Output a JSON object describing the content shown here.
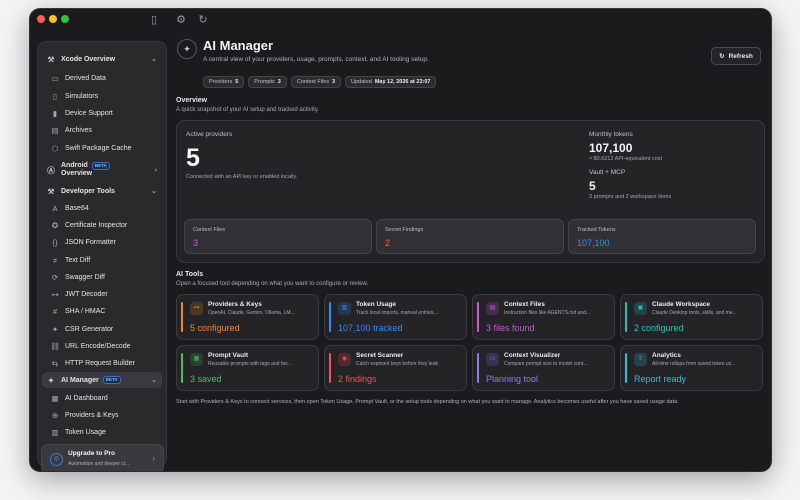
{
  "colors": {
    "window_bg": "#1b1b1d",
    "sidebar_bg": "#2a2a2d",
    "orange": "#f08a24",
    "blue": "#2f8cff",
    "magenta": "#c85ad8",
    "teal": "#22c3c8",
    "green": "#3ec45a",
    "red": "#ff4d4f",
    "purple": "#8b7cf6",
    "cyan": "#35b8e8"
  },
  "sidebar": {
    "items": [
      {
        "label": "Xcode Overview",
        "icon": "hammer-icon",
        "group": true
      },
      {
        "label": "Derived Data",
        "icon": "drive-icon"
      },
      {
        "label": "Simulators",
        "icon": "device-icon"
      },
      {
        "label": "Device Support",
        "icon": "phone-icon"
      },
      {
        "label": "Archives",
        "icon": "archive-icon"
      },
      {
        "label": "Swift Package Cache",
        "icon": "package-icon"
      },
      {
        "label": "Android",
        "label2": "Overview",
        "badge": "BETA",
        "icon": "android-icon",
        "group": true
      },
      {
        "label": "Developer Tools",
        "icon": "tools-icon",
        "group": true
      },
      {
        "label": "Base64",
        "icon": "text-icon"
      },
      {
        "label": "Certificate Inspector",
        "icon": "certificate-icon"
      },
      {
        "label": "JSON Formatter",
        "icon": "braces-icon"
      },
      {
        "label": "Text Diff",
        "icon": "diff-icon"
      },
      {
        "label": "Swagger Diff",
        "icon": "swagger-icon"
      },
      {
        "label": "JWT Decoder",
        "icon": "key-icon"
      },
      {
        "label": "SHA / HMAC",
        "icon": "hash-icon"
      },
      {
        "label": "CSR Generator",
        "icon": "seal-icon"
      },
      {
        "label": "URL Encode/Decode",
        "icon": "link-icon"
      },
      {
        "label": "HTTP Request Builder",
        "icon": "request-icon"
      },
      {
        "label": "AI Manager",
        "badge": "BETA",
        "icon": "sparkle-icon",
        "group": true,
        "active": true
      },
      {
        "label": "AI Dashboard",
        "icon": "dashboard-icon"
      },
      {
        "label": "Providers & Keys",
        "icon": "provider-icon"
      },
      {
        "label": "Token Usage",
        "icon": "chart-icon"
      }
    ],
    "upgrade": {
      "title": "Upgrade to Pro",
      "subtitle": "Automation and deeper cl..."
    }
  },
  "header": {
    "title": "AI Manager",
    "subtitle": "A central view of your providers, usage, prompts, context, and AI tooling setup.",
    "refresh_label": "Refresh",
    "chips": [
      {
        "label": "Providers",
        "value": "5"
      },
      {
        "label": "Prompts",
        "value": "3"
      },
      {
        "label": "Context Files",
        "value": "3"
      },
      {
        "label": "Updated",
        "value": "May 12, 2026 at 23:07"
      }
    ]
  },
  "overview": {
    "title": "Overview",
    "subtitle": "A quick snapshot of your AI setup and tracked activity.",
    "active_label": "Active providers",
    "active_value": "5",
    "active_note": "Connected with an API key or enabled locally.",
    "monthly_label": "Monthly tokens",
    "monthly_value": "107,100",
    "monthly_note": "≈ $0.6212 API-equivalent cost",
    "vault_label": "Vault + MCP",
    "vault_value": "5",
    "vault_note": "3 prompts and 2 workspace items",
    "stats": [
      {
        "label": "Context Files",
        "value": "3",
        "color": "#c85ad8"
      },
      {
        "label": "Secret Findings",
        "value": "2",
        "color": "#ff5a4f"
      },
      {
        "label": "Tracked Tokens",
        "value": "107,100",
        "color": "#2f8cff"
      }
    ]
  },
  "ai_tools": {
    "title": "AI Tools",
    "subtitle": "Open a focused tool depending on what you want to configure or review.",
    "cards": [
      {
        "title": "Providers & Keys",
        "desc": "OpenAI, Claude, Gemini, Ollama, LM...",
        "value": "5 configured",
        "color": "#f08a24",
        "icon": "key-icon",
        "glyph": "⊶"
      },
      {
        "title": "Token Usage",
        "desc": "Track local imports, manual entries,...",
        "value": "107,100 tracked",
        "color": "#2f8cff",
        "icon": "chart-icon",
        "glyph": "▥"
      },
      {
        "title": "Context Files",
        "desc": "Instruction files like AGENTS.md and...",
        "value": "3 files found",
        "color": "#c85ad8",
        "icon": "document-icon",
        "glyph": "▤"
      },
      {
        "title": "Claude Workspace",
        "desc": "Claude Desktop tools, skills, and me...",
        "value": "2 configured",
        "color": "#22c3c8",
        "icon": "workspace-icon",
        "glyph": "▣"
      },
      {
        "title": "Prompt Vault",
        "desc": "Reusable prompts with tags and fav...",
        "value": "3 saved",
        "color": "#3ec45a",
        "icon": "vault-icon",
        "glyph": "▦"
      },
      {
        "title": "Secret Scanner",
        "desc": "Catch exposed keys before they leak",
        "value": "2 findings",
        "color": "#ff4d4f",
        "icon": "eye-icon",
        "glyph": "◉"
      },
      {
        "title": "Context Visualizer",
        "desc": "Compare prompt size to model cont...",
        "value": "Planning tool",
        "color": "#8b7cf6",
        "icon": "monitor-icon",
        "glyph": "▭"
      },
      {
        "title": "Analytics",
        "desc": "All-time rollups from saved token us...",
        "value": "Report ready",
        "color": "#35b8e8",
        "icon": "export-icon",
        "glyph": "⇧"
      }
    ],
    "footer": "Start with Providers & Keys to connect services, then open Token Usage, Prompt Vault, or the setup tools depending on what you want to manage. Analytics becomes useful after you have saved usage data."
  }
}
